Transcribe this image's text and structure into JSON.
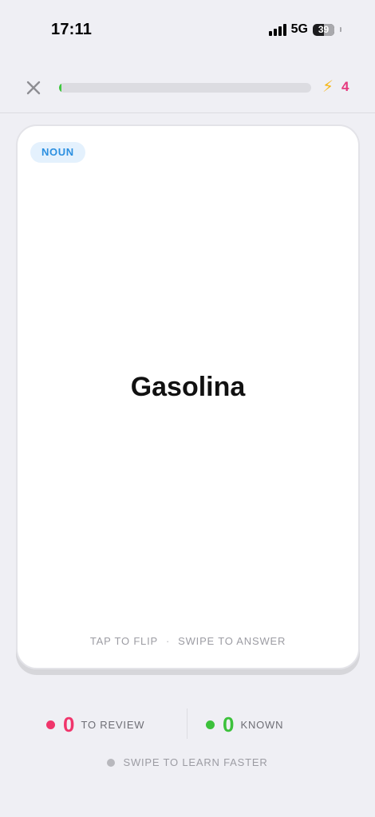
{
  "status_bar": {
    "time": "17:11",
    "network": "5G",
    "battery_level": "39"
  },
  "top_bar": {
    "progress_fraction": 0.005,
    "progress_color": "#3ec83e",
    "streak_icon": "lightning-bolt-icon",
    "streak_count": "4",
    "streak_color": "#e5397e"
  },
  "card": {
    "part_of_speech": "NOUN",
    "word": "Gasolina",
    "hint_left": "TAP TO FLIP",
    "hint_separator": "·",
    "hint_right": "SWIPE TO ANSWER"
  },
  "counters": {
    "review": {
      "count": "0",
      "label": "TO REVIEW",
      "color": "#f0356b"
    },
    "known": {
      "count": "0",
      "label": "KNOWN",
      "color": "#3cc13b"
    }
  },
  "footer": {
    "tip": "SWIPE TO LEARN FASTER"
  }
}
